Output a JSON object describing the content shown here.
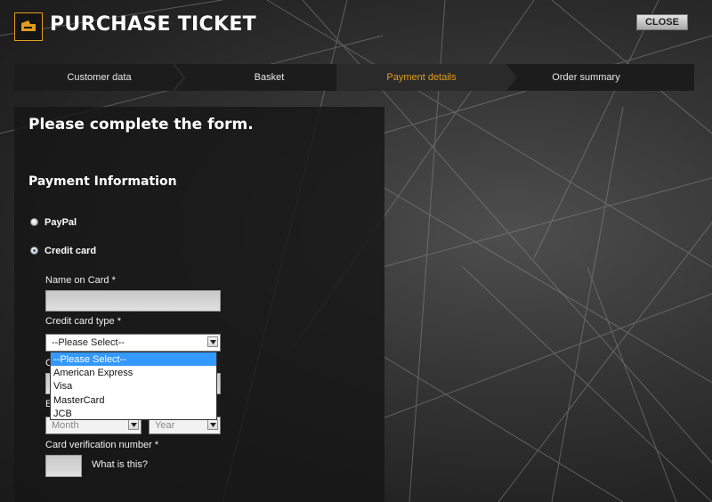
{
  "header": {
    "title": "PURCHASE TICKET",
    "close_label": "CLOSE",
    "logo_icon": "ticket-icon"
  },
  "steps": [
    {
      "label": "Customer data",
      "active": false
    },
    {
      "label": "Basket",
      "active": false
    },
    {
      "label": "Payment details",
      "active": true
    },
    {
      "label": "Order summary",
      "active": false
    }
  ],
  "form": {
    "heading": "Please complete the form.",
    "section_title": "Payment Information",
    "payment_methods": [
      {
        "label": "PayPal",
        "selected": false
      },
      {
        "label": "Credit card",
        "selected": true
      }
    ],
    "name_on_card": {
      "label": "Name on Card *",
      "value": ""
    },
    "card_type": {
      "label": "Credit card type *",
      "value": "--Please Select--",
      "options": [
        "--Please Select--",
        "American Express",
        "Visa",
        "MasterCard",
        "JCB"
      ]
    },
    "expiry": {
      "month_placeholder": "Month",
      "year_placeholder": "Year"
    },
    "cvv": {
      "label": "Card verification number *",
      "value": "",
      "help_link": "What is this?"
    }
  },
  "colors": {
    "accent": "#e39b1f",
    "active_step": "#e39b1f",
    "highlight": "#3399ff"
  }
}
